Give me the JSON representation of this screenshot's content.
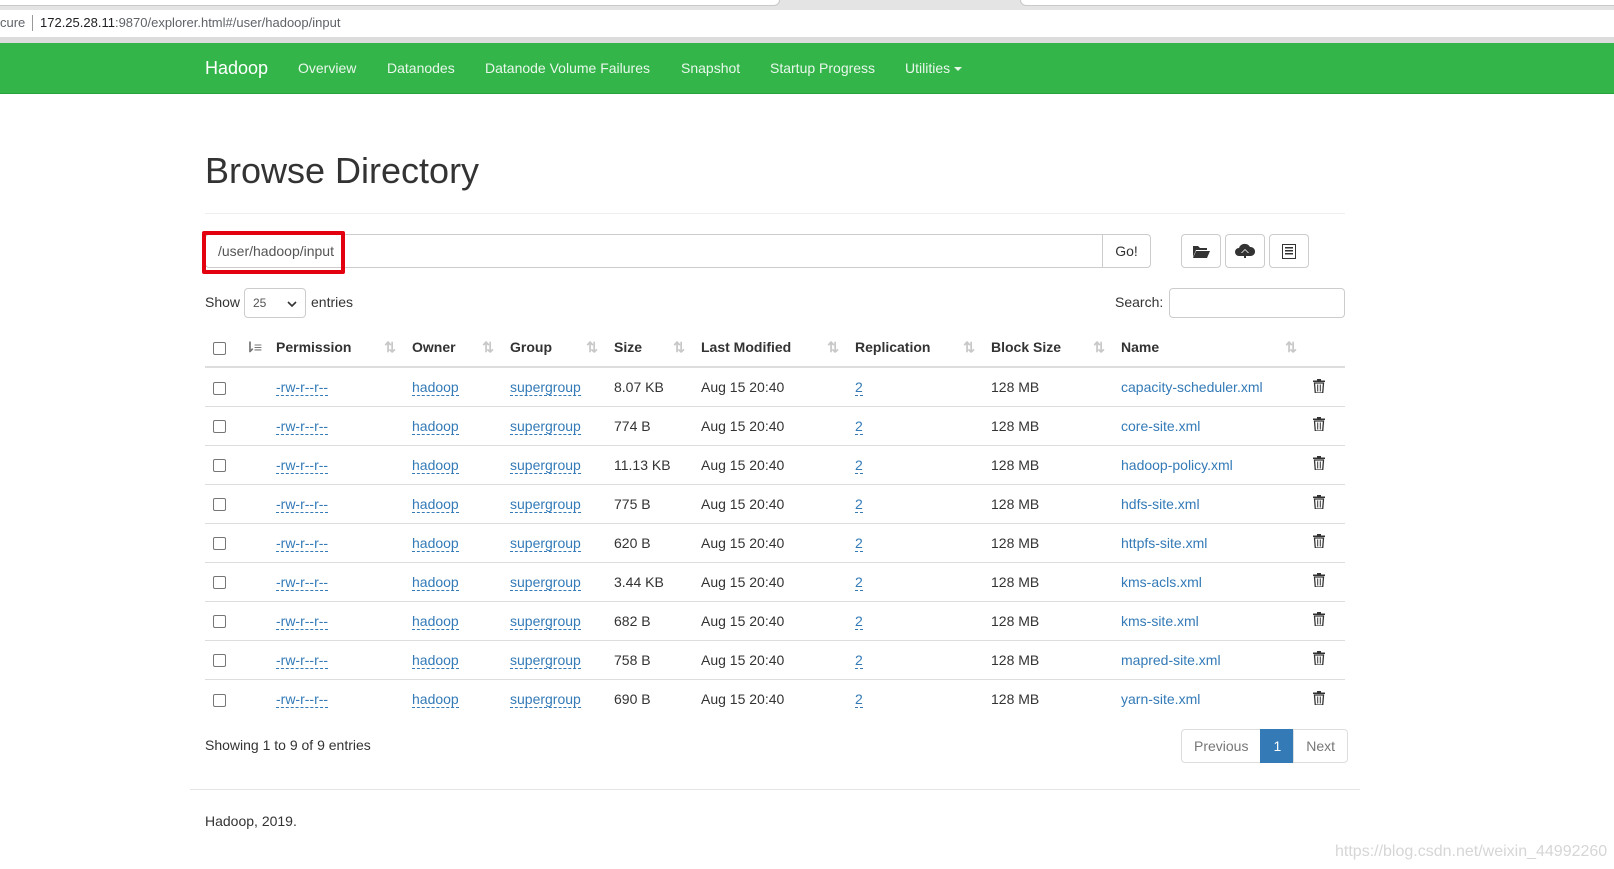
{
  "browser": {
    "secure_text": "cure",
    "url_host": "172.25.28.11",
    "url_rest": ":9870/explorer.html#/user/hadoop/input"
  },
  "navbar": {
    "brand": "Hadoop",
    "items": [
      "Overview",
      "Datanodes",
      "Datanode Volume Failures",
      "Snapshot",
      "Startup Progress",
      "Utilities"
    ],
    "color": "#33b54a"
  },
  "page": {
    "title": "Browse Directory",
    "path_value": "/user/hadoop/input",
    "go_label": "Go!",
    "toolbar_icons": [
      "folder-open-icon",
      "cloud-upload-icon",
      "list-alt-icon"
    ]
  },
  "length": {
    "show_label": "Show",
    "selected": "25",
    "entries_label": "entries"
  },
  "search": {
    "label": "Search:"
  },
  "table": {
    "headers": [
      "Permission",
      "Owner",
      "Group",
      "Size",
      "Last Modified",
      "Replication",
      "Block Size",
      "Name"
    ],
    "rows": [
      {
        "permission": "-rw-r--r--",
        "owner": "hadoop",
        "group": "supergroup",
        "size": "8.07 KB",
        "modified": "Aug 15 20:40",
        "replication": "2",
        "block_size": "128 MB",
        "name": "capacity-scheduler.xml"
      },
      {
        "permission": "-rw-r--r--",
        "owner": "hadoop",
        "group": "supergroup",
        "size": "774 B",
        "modified": "Aug 15 20:40",
        "replication": "2",
        "block_size": "128 MB",
        "name": "core-site.xml"
      },
      {
        "permission": "-rw-r--r--",
        "owner": "hadoop",
        "group": "supergroup",
        "size": "11.13 KB",
        "modified": "Aug 15 20:40",
        "replication": "2",
        "block_size": "128 MB",
        "name": "hadoop-policy.xml"
      },
      {
        "permission": "-rw-r--r--",
        "owner": "hadoop",
        "group": "supergroup",
        "size": "775 B",
        "modified": "Aug 15 20:40",
        "replication": "2",
        "block_size": "128 MB",
        "name": "hdfs-site.xml"
      },
      {
        "permission": "-rw-r--r--",
        "owner": "hadoop",
        "group": "supergroup",
        "size": "620 B",
        "modified": "Aug 15 20:40",
        "replication": "2",
        "block_size": "128 MB",
        "name": "httpfs-site.xml"
      },
      {
        "permission": "-rw-r--r--",
        "owner": "hadoop",
        "group": "supergroup",
        "size": "3.44 KB",
        "modified": "Aug 15 20:40",
        "replication": "2",
        "block_size": "128 MB",
        "name": "kms-acls.xml"
      },
      {
        "permission": "-rw-r--r--",
        "owner": "hadoop",
        "group": "supergroup",
        "size": "682 B",
        "modified": "Aug 15 20:40",
        "replication": "2",
        "block_size": "128 MB",
        "name": "kms-site.xml"
      },
      {
        "permission": "-rw-r--r--",
        "owner": "hadoop",
        "group": "supergroup",
        "size": "758 B",
        "modified": "Aug 15 20:40",
        "replication": "2",
        "block_size": "128 MB",
        "name": "mapred-site.xml"
      },
      {
        "permission": "-rw-r--r--",
        "owner": "hadoop",
        "group": "supergroup",
        "size": "690 B",
        "modified": "Aug 15 20:40",
        "replication": "2",
        "block_size": "128 MB",
        "name": "yarn-site.xml"
      }
    ]
  },
  "pagination": {
    "info": "Showing 1 to 9 of 9 entries",
    "previous": "Previous",
    "current": "1",
    "next": "Next"
  },
  "footer": {
    "text": "Hadoop, 2019."
  },
  "watermark": "https://blog.csdn.net/weixin_44992260"
}
